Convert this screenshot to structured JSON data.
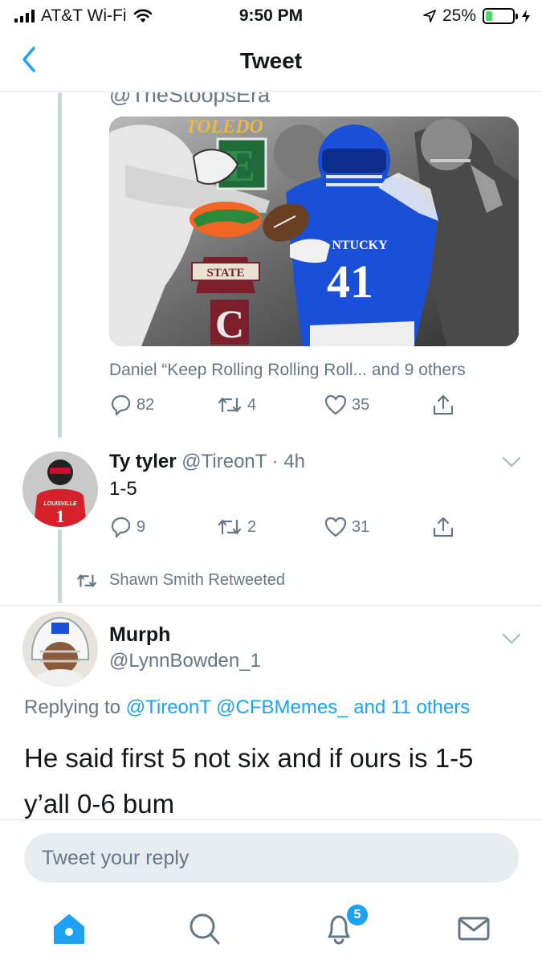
{
  "status_bar": {
    "carrier": "AT&T Wi-Fi",
    "time": "9:50 PM",
    "battery_percent": "25%",
    "battery_level": 0.25,
    "battery_color": "#4cd964"
  },
  "nav": {
    "title": "Tweet",
    "back_icon": "chevron-left-icon"
  },
  "thread": {
    "cut_off_handle": "@TheStoopsEra",
    "media_card": {
      "logo_texts": [
        "TOLEDO",
        "STATE"
      ],
      "jersey_text": "NTUCKY",
      "jersey_number": "41"
    },
    "likers_text": "Daniel “Keep Rolling Rolling Roll... and 9 others",
    "actions": {
      "replies": "82",
      "retweets": "4",
      "likes": "35"
    }
  },
  "tweet_ty": {
    "name": "Ty tyler",
    "handle": "@TireonT",
    "time": "· 4h",
    "text": "1-5",
    "avatar_jersey_text": "LOUISVILLE",
    "actions": {
      "replies": "9",
      "retweets": "2",
      "likes": "31"
    }
  },
  "retweet_context": "Shawn Smith Retweeted",
  "tweet_murph": {
    "name": "Murph",
    "handle": "@LynnBowden_1",
    "replying_prefix": "Replying to",
    "replying_users": "@TireonT @CFBMemes_ and 11 others",
    "text": "He said first 5 not six and if ours is 1-5 y’all 0-6 bum"
  },
  "reply": {
    "placeholder": "Tweet your reply"
  },
  "tab_bar": {
    "items": [
      "home-icon",
      "search-icon",
      "notifications-icon",
      "messages-icon"
    ],
    "notification_badge": "5"
  },
  "colors": {
    "accent": "#1da1f2",
    "muted": "#657786",
    "kentucky_blue": "#1a4fd8"
  }
}
